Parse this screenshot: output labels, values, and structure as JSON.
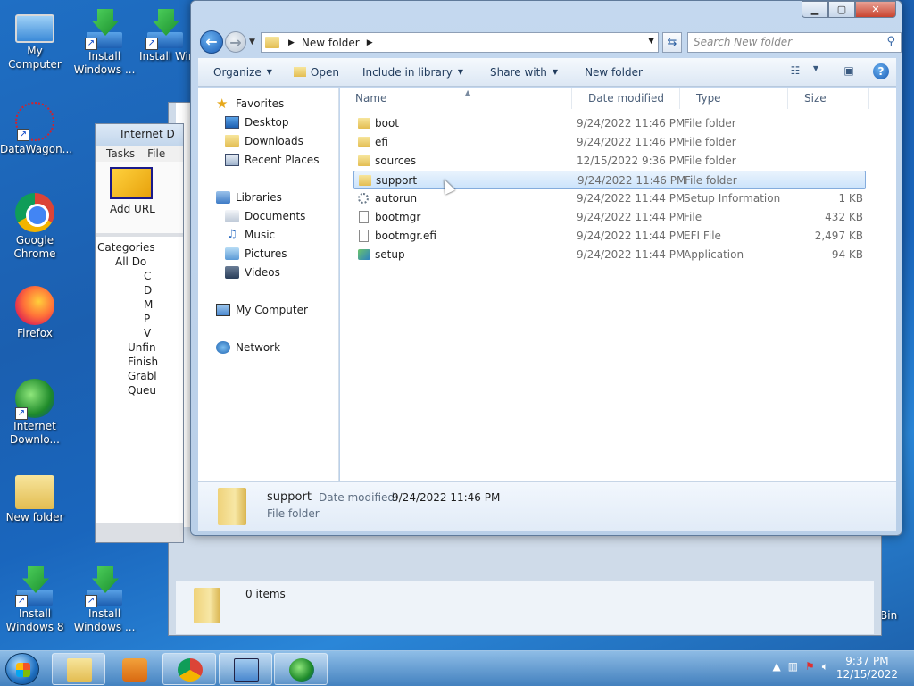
{
  "desktop": {
    "icons": [
      {
        "label": "My Computer",
        "icon": "computer-icon"
      },
      {
        "label": "Install Windows ...",
        "icon": "install-icon"
      },
      {
        "label": "Install Windows ...",
        "icon": "install-icon"
      },
      {
        "label": "DataWagon...",
        "icon": "datawagon-icon"
      },
      {
        "label": "Google Chrome",
        "icon": "chrome-icon"
      },
      {
        "label": "Firefox",
        "icon": "firefox-icon"
      },
      {
        "label": "Internet Downlo...",
        "icon": "idm-icon"
      },
      {
        "label": "New folder",
        "icon": "folder-icon"
      },
      {
        "label": "Install Windows 8",
        "icon": "install-icon"
      },
      {
        "label": "Install Windows ...",
        "icon": "install-icon"
      }
    ],
    "recycle_bin_partial": "Bin"
  },
  "idm_window": {
    "title": "Internet D",
    "menu": [
      "Tasks",
      "File"
    ],
    "add_url": "Add URL",
    "categories_label": "Categories",
    "tree": [
      "All Do",
      "C",
      "D",
      "M",
      "P",
      "V",
      "Unfin",
      "Finish",
      "Grabl",
      "Queu"
    ]
  },
  "bg_explorer": {
    "items_count": "0 items"
  },
  "explorer": {
    "address": {
      "crumb": "New folder"
    },
    "search_placeholder": "Search New folder",
    "toolbar": {
      "organize": "Organize",
      "open": "Open",
      "include_in_library": "Include in library",
      "share_with": "Share with",
      "new_folder": "New folder"
    },
    "nav": {
      "favorites": "Favorites",
      "desktop": "Desktop",
      "downloads": "Downloads",
      "recent_places": "Recent Places",
      "libraries": "Libraries",
      "documents": "Documents",
      "music": "Music",
      "pictures": "Pictures",
      "videos": "Videos",
      "my_computer": "My Computer",
      "network": "Network"
    },
    "columns": {
      "name": "Name",
      "date_modified": "Date modified",
      "type": "Type",
      "size": "Size"
    },
    "files": [
      {
        "name": "boot",
        "date": "9/24/2022 11:46 PM",
        "type": "File folder",
        "size": "",
        "icon": "folder-icon"
      },
      {
        "name": "efi",
        "date": "9/24/2022 11:46 PM",
        "type": "File folder",
        "size": "",
        "icon": "folder-icon"
      },
      {
        "name": "sources",
        "date": "12/15/2022 9:36 PM",
        "type": "File folder",
        "size": "",
        "icon": "folder-icon"
      },
      {
        "name": "support",
        "date": "9/24/2022 11:46 PM",
        "type": "File folder",
        "size": "",
        "icon": "folder-icon",
        "selected": true
      },
      {
        "name": "autorun",
        "date": "9/24/2022 11:44 PM",
        "type": "Setup Information",
        "size": "1 KB",
        "icon": "settings-file-icon"
      },
      {
        "name": "bootmgr",
        "date": "9/24/2022 11:44 PM",
        "type": "File",
        "size": "432 KB",
        "icon": "file-icon"
      },
      {
        "name": "bootmgr.efi",
        "date": "9/24/2022 11:44 PM",
        "type": "EFI File",
        "size": "2,497 KB",
        "icon": "file-icon"
      },
      {
        "name": "setup",
        "date": "9/24/2022 11:44 PM",
        "type": "Application",
        "size": "94 KB",
        "icon": "setup-app-icon"
      }
    ],
    "details": {
      "name": "support",
      "date_label": "Date modified:",
      "date_value": "9/24/2022 11:46 PM",
      "type": "File folder"
    }
  },
  "taskbar": {
    "clock_time": "9:37 PM",
    "clock_date": "12/15/2022"
  }
}
